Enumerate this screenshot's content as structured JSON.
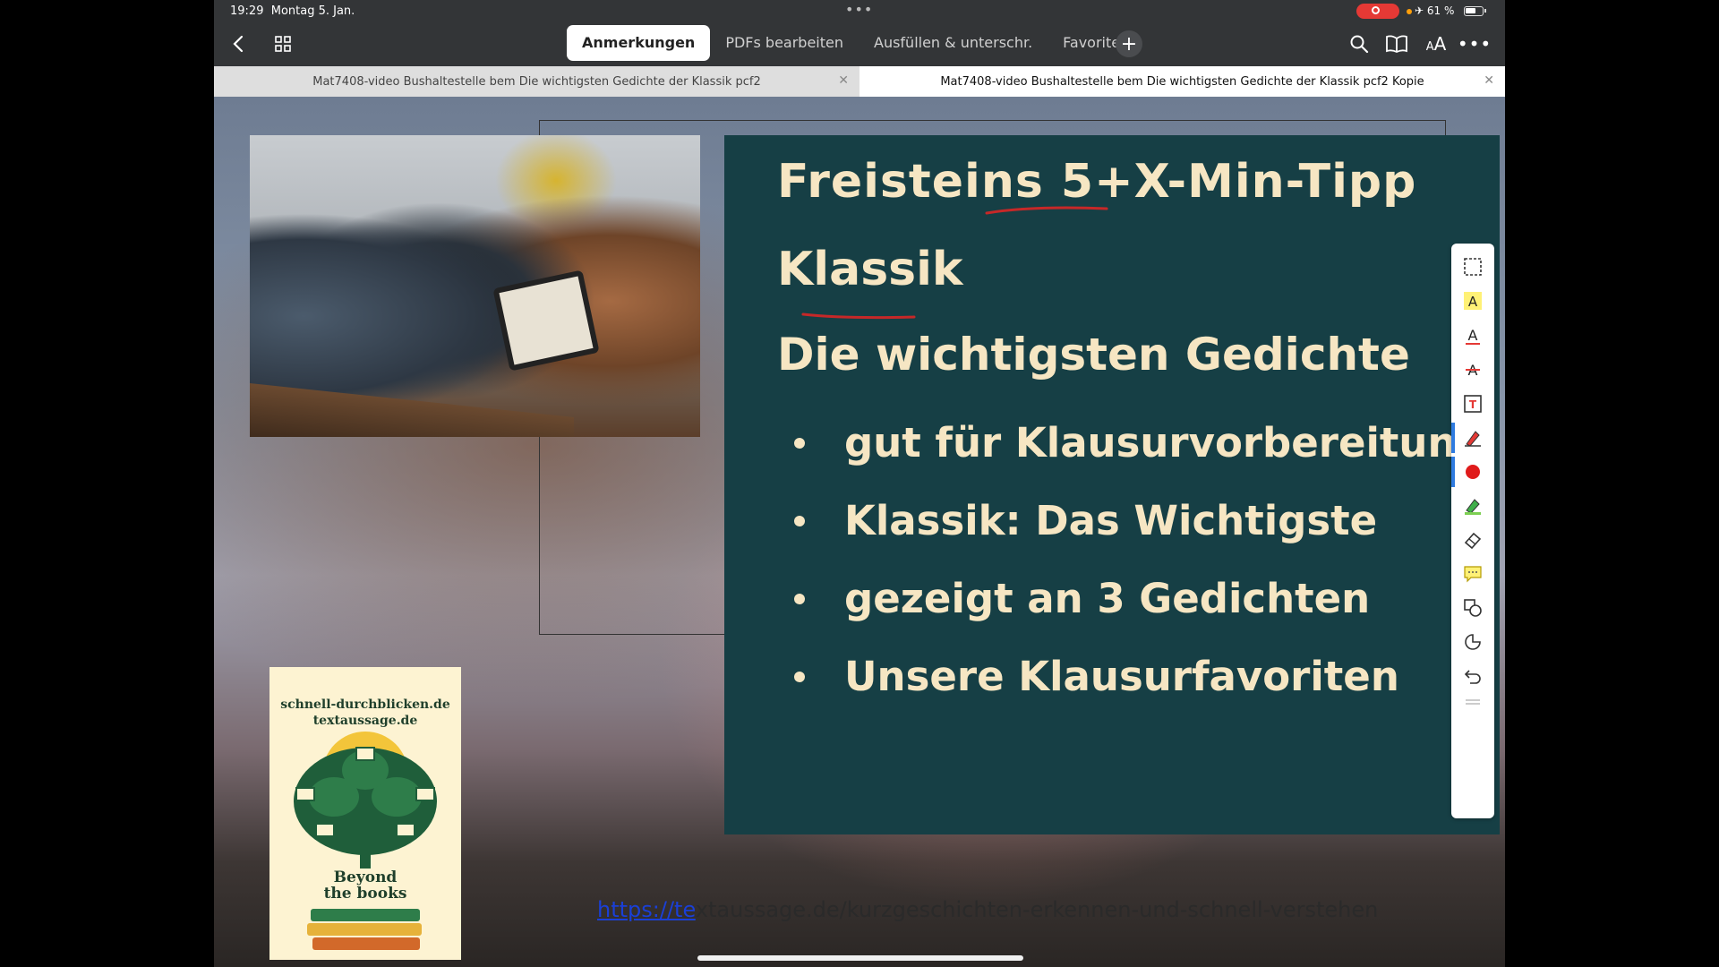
{
  "status_bar": {
    "time": "19:29",
    "date": "Montag 5. Jan.",
    "battery": "61 %",
    "recording_color": "#e53935"
  },
  "toolbar": {
    "tabs": [
      {
        "label": "Anmerkungen",
        "active": true
      },
      {
        "label": "PDFs bearbeiten",
        "active": false
      },
      {
        "label": "Ausfüllen & unterschr.",
        "active": false
      },
      {
        "label": "Favoriten",
        "active": false
      }
    ],
    "aa_label": "AA",
    "more_label": "•••"
  },
  "documents": [
    {
      "title": "Mat7408-video Bushaltestelle bem Die wichtigsten Gedichte der Klassik pcf2",
      "active": false
    },
    {
      "title": "Mat7408-video Bushaltestelle bem Die wichtigsten Gedichte der Klassik pcf2 Kopie",
      "active": true
    }
  ],
  "slide": {
    "title_line1": "Freisteins 5+X-Min-Tipp",
    "title_line2": "Klassik",
    "heading": "Die wichtigsten Gedichte",
    "bullets": [
      "gut für Klausurvorbereitung",
      "Klassik: Das Wichtigste",
      "gezeigt an 3 Gedichten",
      "Unsere Klausurfavoriten"
    ],
    "background": "#163f45",
    "text_color": "#f6e6c3",
    "underline_color": "#c62828"
  },
  "logo": {
    "line1": "schnell-durchblicken.de",
    "line2": "textaussage.de",
    "line3": "Beyond",
    "line4": "the books"
  },
  "footer": {
    "url_link_part": "https://te",
    "url_rest": "xtaussage.de/kurzgeschichten-erkennen-und-schnell-verstehen"
  },
  "tools": [
    "select-area-icon",
    "highlight-text-icon",
    "underline-text-icon",
    "strikethrough-text-icon",
    "textbox-icon",
    "pen-icon",
    "color-dot-icon",
    "highlighter-icon",
    "eraser-icon",
    "comment-icon",
    "shapes-icon",
    "stamp-icon",
    "undo-icon"
  ],
  "accent_color": "#2f7be0"
}
